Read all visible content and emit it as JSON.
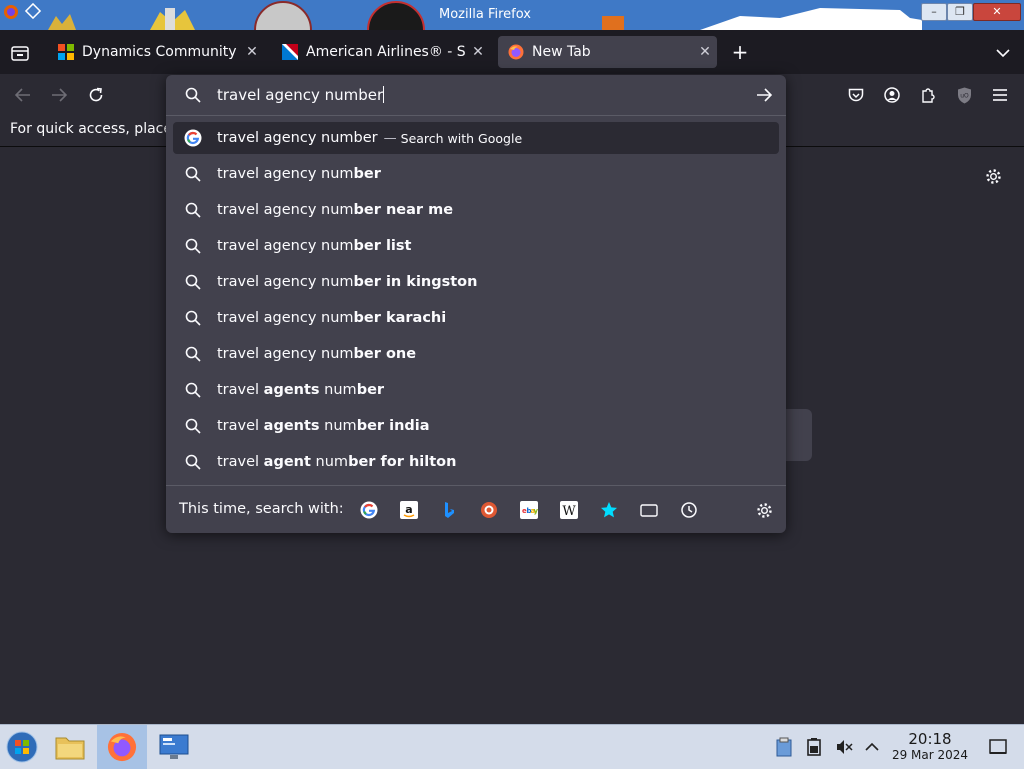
{
  "window": {
    "title": "Mozilla Firefox",
    "min_label": "–",
    "max_label": "❐",
    "close_label": "✕"
  },
  "tabs": [
    {
      "label": "Dynamics Community Fo",
      "favicon": "microsoft-logo"
    },
    {
      "label": "American Airlines® - Sea",
      "favicon": "american-airlines-logo"
    },
    {
      "label": "New Tab",
      "favicon": "firefox-logo",
      "active": true
    }
  ],
  "tab_close": "✕",
  "new_tab": "+",
  "bookmarks_bar": {
    "message": "For quick access, place"
  },
  "urlbar": {
    "value": "travel agency number",
    "suggestions": [
      {
        "normal": "travel agency number",
        "bold": "",
        "hint": "Search with Google",
        "selected": true,
        "icon": "google-icon"
      },
      {
        "normal": "travel agency num",
        "bold": "ber",
        "icon": "search-icon"
      },
      {
        "normal": "travel agency num",
        "bold": "ber near me",
        "icon": "search-icon"
      },
      {
        "normal": "travel agency num",
        "bold": "ber list",
        "icon": "search-icon"
      },
      {
        "normal": "travel agency num",
        "bold": "ber in kingston",
        "icon": "search-icon"
      },
      {
        "normal": "travel agency num",
        "bold": "ber karachi",
        "icon": "search-icon"
      },
      {
        "normal": "travel agency num",
        "bold": "ber one",
        "icon": "search-icon"
      },
      {
        "parts": [
          {
            "t": "travel ",
            "b": false
          },
          {
            "t": "agents",
            "b": true
          },
          {
            "t": " num",
            "b": false
          },
          {
            "t": "ber",
            "b": true
          }
        ],
        "icon": "search-icon"
      },
      {
        "parts": [
          {
            "t": "travel ",
            "b": false
          },
          {
            "t": "agents",
            "b": true
          },
          {
            "t": " num",
            "b": false
          },
          {
            "t": "ber india",
            "b": true
          }
        ],
        "icon": "search-icon"
      },
      {
        "parts": [
          {
            "t": "travel ",
            "b": false
          },
          {
            "t": "agent",
            "b": true
          },
          {
            "t": " num",
            "b": false
          },
          {
            "t": "ber for hilton",
            "b": true
          }
        ],
        "icon": "search-icon"
      }
    ],
    "one_off_label": "This time, search with:",
    "engines": [
      "google",
      "amazon",
      "bing",
      "duckduckgo",
      "ebay",
      "wikipedia",
      "bookmarks",
      "tabs",
      "history"
    ]
  },
  "taskbar": {
    "time": "20:18",
    "date": "29 Mar 2024"
  },
  "colors": {
    "panel": "#42414d",
    "toolbar": "#2b2a33",
    "tabstrip": "#1c1b22",
    "accent": "#00ddff"
  }
}
